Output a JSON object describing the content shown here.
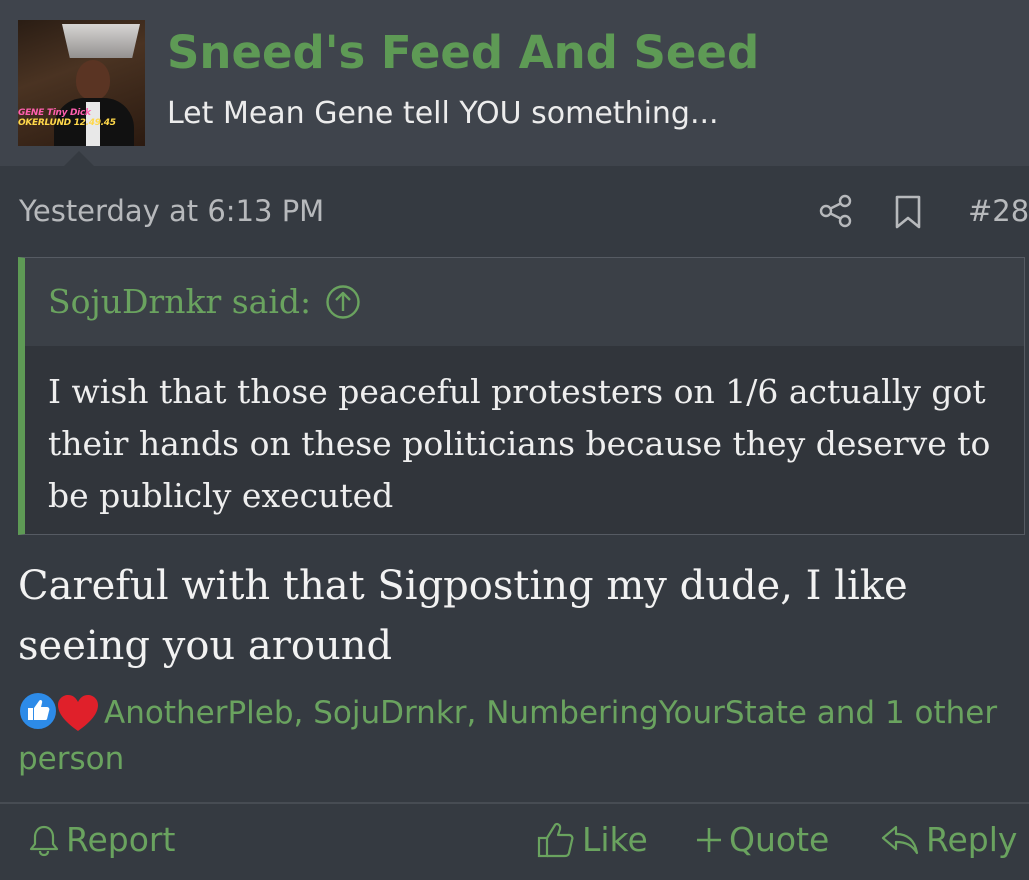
{
  "forum": {
    "title": "Sneed's Feed And Seed",
    "subtitle": "Let Mean Gene tell YOU something...",
    "avatar_lowerthird": {
      "line1": "GENE ",
      "line1_accent": "Tiny Dick",
      "line2": "OKERLUND 12.49.45"
    }
  },
  "post": {
    "date": "Yesterday at 6:13 PM",
    "number": "#28",
    "quote": {
      "author": "SojuDrnkr said:",
      "text": "I wish that those peaceful protesters on 1/6 actually got their hands on these politicians because they deserve to be publicly executed"
    },
    "body": "Careful with that Sigposting my dude, I like seeing you around",
    "reactions": {
      "text": "AnotherPleb, SojuDrnkr, NumberingYourState and 1 other person",
      "types": [
        "like",
        "love"
      ]
    }
  },
  "actions": {
    "report": "Report",
    "like": "Like",
    "quote": "Quote",
    "reply": "Reply"
  },
  "colors": {
    "accent": "#5e9a55",
    "background": "#353a41",
    "header": "#3f444c",
    "like_blue": "#2d8be8",
    "love_red": "#e0202a"
  }
}
